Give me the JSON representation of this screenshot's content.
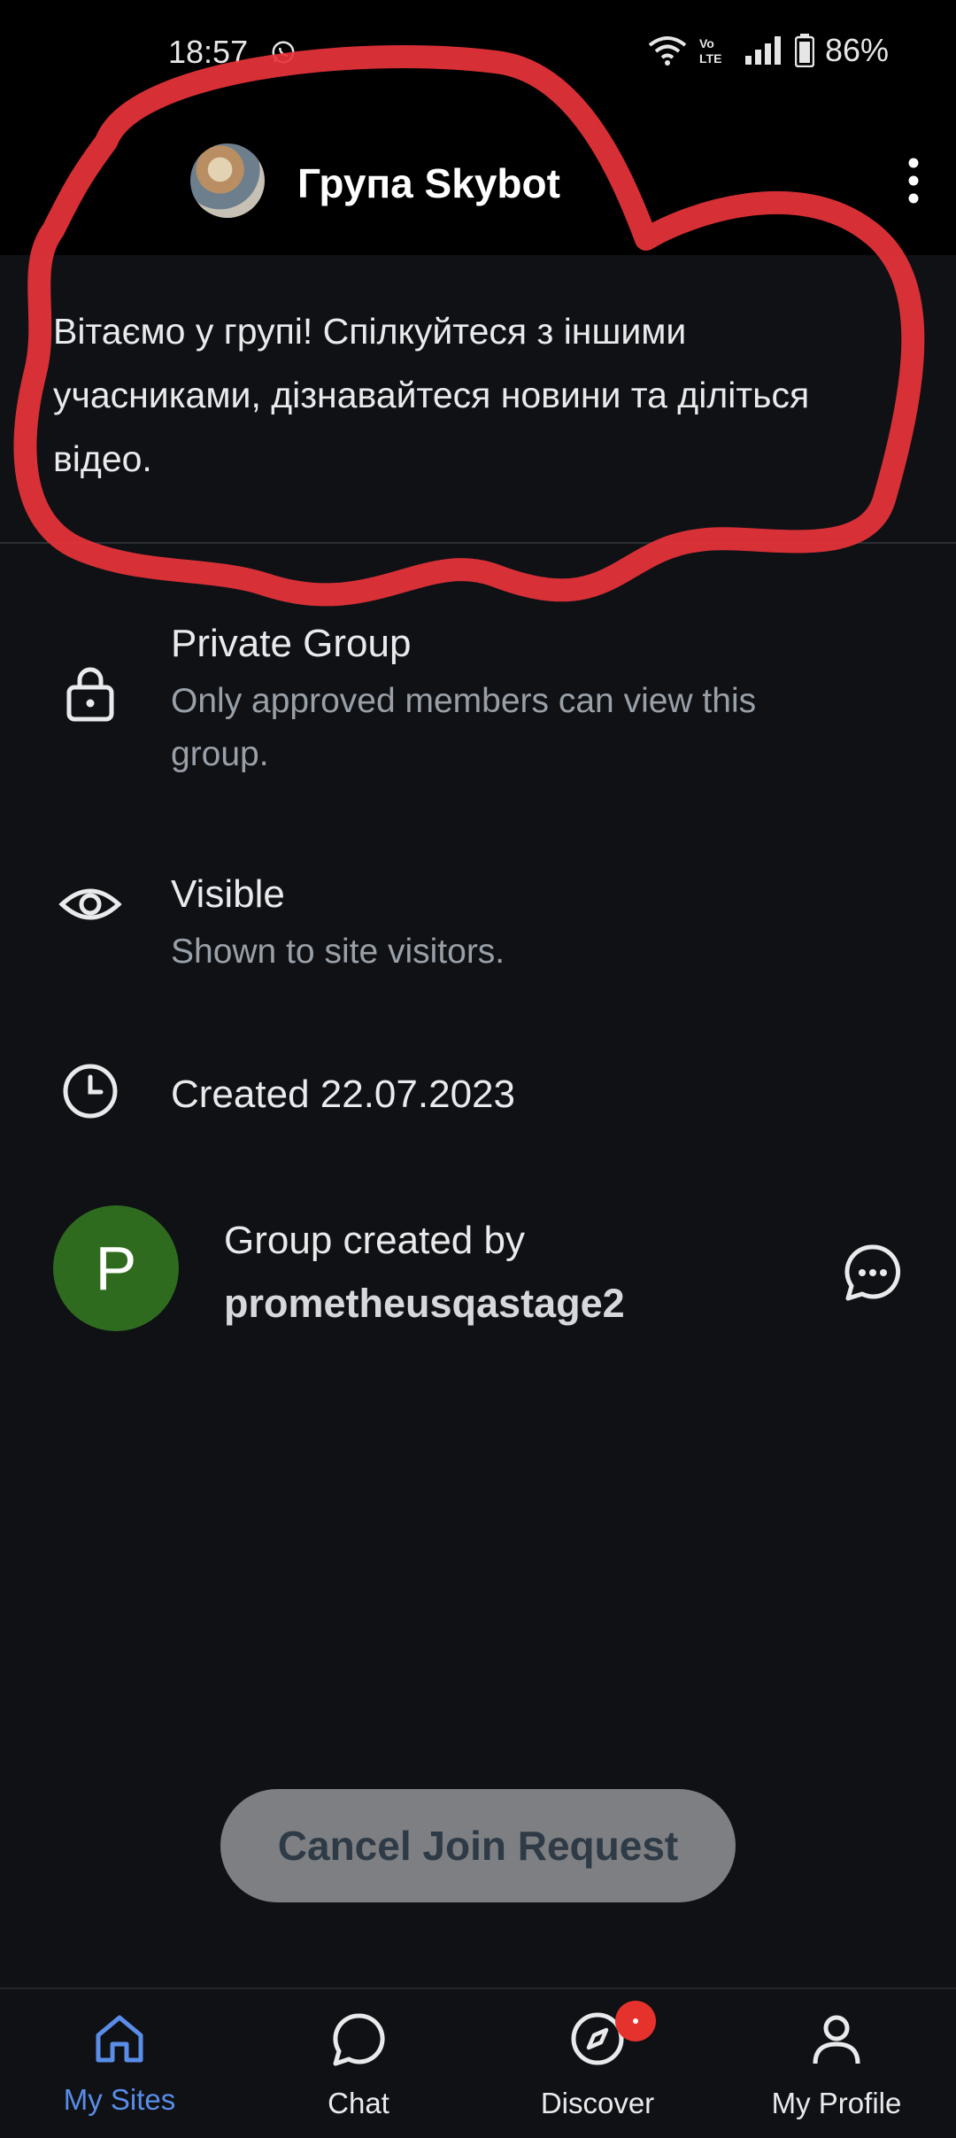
{
  "status_bar": {
    "time": "18:57",
    "battery": "86%",
    "lte_label": "Vo LTE"
  },
  "header": {
    "title": "Група Skybot"
  },
  "description": "Вітаємо у групі! Спілкуйтеся з іншими учасниками, дізнавайтеся новини та діліться відео.",
  "info": {
    "privacy_title": "Private Group",
    "privacy_sub": "Only approved members can view this group.",
    "visibility_title": "Visible",
    "visibility_sub": "Shown to site visitors.",
    "created": "Created 22.07.2023"
  },
  "creator": {
    "initial": "P",
    "label": "Group created by",
    "name": "prometheusqastage2"
  },
  "cancel_button": "Cancel Join Request",
  "nav": {
    "my_sites": "My Sites",
    "chat": "Chat",
    "discover": "Discover",
    "my_profile": "My Profile"
  },
  "colors": {
    "accent": "#5a8de8",
    "creator_avatar": "#2f6b1e",
    "badge": "#e5322d",
    "annotation": "#e8333a"
  }
}
